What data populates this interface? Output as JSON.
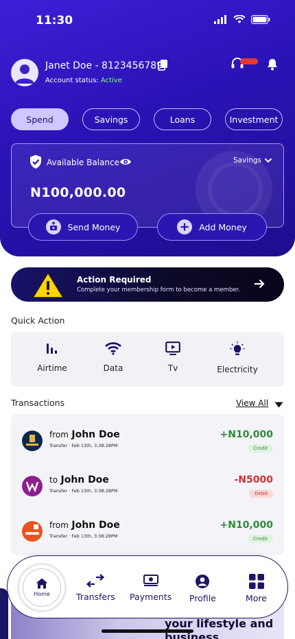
{
  "status_bar": {
    "time": "11:30"
  },
  "profile": {
    "name": "Janet Doe - 8123456789",
    "status_label": "Account status:",
    "status_value": "Active"
  },
  "tabs": [
    {
      "label": "Spend",
      "active": true
    },
    {
      "label": "Savings",
      "active": false
    },
    {
      "label": "Loans",
      "active": false
    },
    {
      "label": "Investment",
      "active": false
    }
  ],
  "balance": {
    "label": "Available Balance",
    "amount": "N100,000.00",
    "account_select": "Savings"
  },
  "actions": {
    "send_money": "Send Money",
    "add_money": "Add Money"
  },
  "banner": {
    "title": "Action Required",
    "subtitle": "Complete your membership form to become a member."
  },
  "quick_action": {
    "title": "Quick Action",
    "items": [
      {
        "label": "Airtime",
        "icon": "signal-bars-icon"
      },
      {
        "label": "Data",
        "icon": "wifi-icon"
      },
      {
        "label": "Tv",
        "icon": "tv-play-icon"
      },
      {
        "label": "Electricity",
        "icon": "bulb-icon"
      }
    ]
  },
  "transactions": {
    "title": "Transactions",
    "view_all": "View All",
    "items": [
      {
        "direction": "from",
        "name": "John Doe",
        "meta": "Transfer · Feb 13th, 3:38:28PM",
        "amount": "+N10,000",
        "type": "Credit",
        "bank": "FirstBank"
      },
      {
        "direction": "to",
        "name": "John Doe",
        "meta": "Transfer · Feb 13th, 3:38:28PM",
        "amount": "-N5000",
        "type": "Debit",
        "bank": "Wema"
      },
      {
        "direction": "from",
        "name": "John Doe",
        "meta": "Transfer · Feb 13th, 3:38:28PM",
        "amount": "+N10,000",
        "type": "Credit",
        "bank": "GTBank"
      }
    ]
  },
  "promo": {
    "text_line1": "your lifestyle and",
    "text_line2": "business"
  },
  "bottom_nav": {
    "home": "Home",
    "items": [
      {
        "label": "Transfers",
        "icon": "transfer-arrows-icon"
      },
      {
        "label": "Payments",
        "icon": "payments-icon"
      },
      {
        "label": "Profile",
        "icon": "profile-icon"
      },
      {
        "label": "More",
        "icon": "grid-icon"
      }
    ]
  },
  "colors": {
    "brand": "#2a13b5",
    "active_tab": "#cfc7ff",
    "credit": "#2e8b3a",
    "debit": "#d32f2f",
    "navy": "#1c1566"
  }
}
